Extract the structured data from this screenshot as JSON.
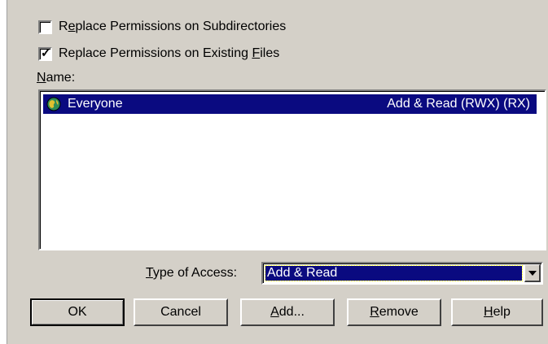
{
  "options": {
    "replace_subdirs": {
      "pre": "R",
      "ul": "e",
      "post": "place Permissions on Subdirectories",
      "checked": false
    },
    "replace_files": {
      "pre": "Replace Permissions on Existing ",
      "ul": "F",
      "post": "iles",
      "checked": true
    }
  },
  "name_label": {
    "ul": "N",
    "post": "ame:"
  },
  "list": {
    "items": [
      {
        "name": "Everyone",
        "access": "Add & Read (RWX) (RX)",
        "icon": "globe-icon",
        "selected": true
      }
    ]
  },
  "type_of_access": {
    "label_ul": "T",
    "label_post": "ype of Access:",
    "selected": "Add & Read"
  },
  "buttons": {
    "ok": {
      "label": "OK"
    },
    "cancel": {
      "label": "Cancel"
    },
    "add": {
      "ul": "A",
      "post": "dd..."
    },
    "remove": {
      "ul": "R",
      "post": "emove"
    },
    "help": {
      "ul": "H",
      "post": "elp"
    }
  },
  "colors": {
    "dialog_bg": "#d4d0c8",
    "selection": "#0a0a80"
  }
}
